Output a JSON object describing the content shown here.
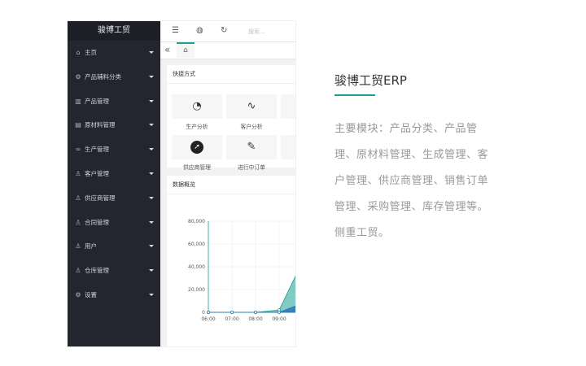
{
  "sidebar": {
    "title": "骏博工贸",
    "items": [
      {
        "label": "主页",
        "icon": "home-icon"
      },
      {
        "label": "产品辅料分类",
        "icon": "gear-icon"
      },
      {
        "label": "产品管理",
        "icon": "library-icon"
      },
      {
        "label": "原材料管理",
        "icon": "chart-icon"
      },
      {
        "label": "生产管理",
        "icon": "link-icon"
      },
      {
        "label": "客户管理",
        "icon": "user-icon"
      },
      {
        "label": "供应商管理",
        "icon": "user-icon"
      },
      {
        "label": "合同管理",
        "icon": "user-icon"
      },
      {
        "label": "用户",
        "icon": "user-icon"
      },
      {
        "label": "仓库管理",
        "icon": "user-icon"
      },
      {
        "label": "设置",
        "icon": "gear-icon"
      }
    ]
  },
  "topbar": {
    "search_placeholder": "搜索..."
  },
  "shortcuts": {
    "title": "快捷方式",
    "items": [
      {
        "label": "生产分析",
        "icon": "gauge-icon"
      },
      {
        "label": "客户分析",
        "icon": "pulse-icon"
      },
      {
        "label": "供应商管理",
        "icon": "compass-icon"
      },
      {
        "label": "进行中订单",
        "icon": "edit-doc-icon"
      }
    ]
  },
  "overview": {
    "title": "数据概览"
  },
  "chart_data": {
    "type": "area",
    "title": "",
    "x": [
      "06:00",
      "07:00",
      "08:00",
      "09:00"
    ],
    "ylim": [
      0,
      80000
    ],
    "yticks": [
      "0",
      "20,000",
      "40,000",
      "60,000",
      "80,000"
    ],
    "series": [
      {
        "values": [
          0,
          0,
          0,
          2000,
          45000
        ],
        "color": "#1aa094"
      },
      {
        "values": [
          0,
          0,
          0,
          0,
          8000
        ],
        "color": "#2b6fb8"
      }
    ]
  },
  "summary": {
    "title": "骏博工贸ERP",
    "text": "主要模块：产品分类、产品管理、原材料管理、生成管理、客户管理、供应商管理、销售订单管理、采购管理、库存管理等。侧重工贸。",
    "accent": "#1aa094"
  }
}
